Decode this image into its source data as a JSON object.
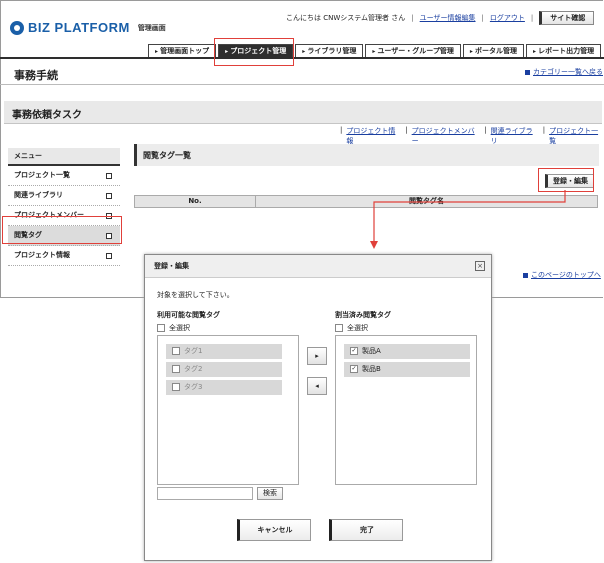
{
  "header": {
    "logo_text": "BIZ PLATFORM",
    "logo_sub": "管理画面",
    "greeting": "こんにちは CNWシステム管理者 さん",
    "user_edit_link": "ユーザー情報編集",
    "logout_link": "ログアウト",
    "site_check": "サイト確認"
  },
  "nav": {
    "tabs": [
      "管理画面トップ",
      "プロジェクト管理",
      "ライブラリ管理",
      "ユーザー・グループ管理",
      "ポータル管理",
      "レポート出力管理"
    ],
    "active_index": 1
  },
  "page": {
    "title": "事務手続",
    "category_link": "カテゴリー一覧へ戻る",
    "task_title": "事務依頼タスク",
    "sublinks": [
      "プロジェクト情報",
      "プロジェクトメンバー",
      "関連ライブラリ",
      "プロジェクト一覧"
    ],
    "main_title": "閲覧タグ一覧",
    "register_button": "登録・編集",
    "table_headers": [
      "No.",
      "閲覧タグ名"
    ],
    "top_link": "このページのトップへ"
  },
  "sidebar": {
    "heading": "メニュー",
    "items": [
      "プロジェクト一覧",
      "関連ライブラリ",
      "プロジェクトメンバー",
      "閲覧タグ",
      "プロジェクト情報"
    ],
    "active_index": 3
  },
  "dialog": {
    "title": "登録・編集",
    "instruction": "対象を選択して下さい。",
    "left_label": "利用可能な閲覧タグ",
    "right_label": "割当済み閲覧タグ",
    "select_all": "全選択",
    "available": [
      "タグ1",
      "タグ2",
      "タグ3"
    ],
    "assigned": [
      "製品A",
      "製品B"
    ],
    "search_button": "検索",
    "cancel_button": "キャンセル",
    "done_button": "完了",
    "close_icon": "close-icon"
  },
  "colors": {
    "accent": "#1a5fa8",
    "highlight": "#e0403a",
    "nav_active": "#2e2e2e"
  }
}
